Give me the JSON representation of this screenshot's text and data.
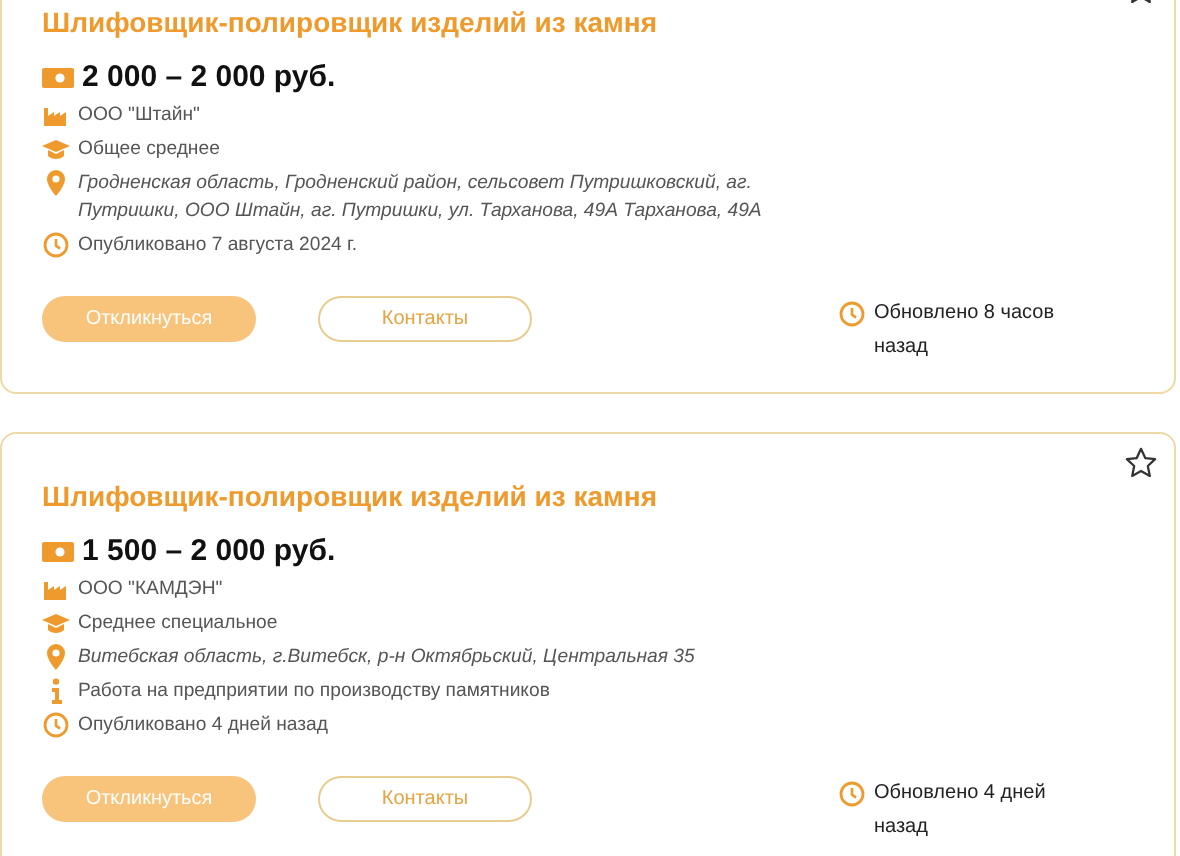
{
  "vacancies": [
    {
      "title": "Шлифовщик-полировщик изделий из камня",
      "salary": "2 000 – 2 000 руб.",
      "details": [
        {
          "kind": "company",
          "text": "ООО \"Штайн\""
        },
        {
          "kind": "education",
          "text": "Общее среднее"
        },
        {
          "kind": "location",
          "text": "Гродненская область, Гродненский район, сельсовет Путришковский, аг. Путришки, ООО Штайн, аг. Путришки, ул. Тарханова, 49А Тарханова, 49А"
        },
        {
          "kind": "published",
          "text": "Опубликовано 7 августа 2024 г."
        }
      ],
      "respond_button": "Откликнуться",
      "contacts_button": "Контакты",
      "updated": "Обновлено 8 часов назад"
    },
    {
      "title": "Шлифовщик-полировщик изделий из камня",
      "salary": "1 500 – 2 000 руб.",
      "details": [
        {
          "kind": "company",
          "text": "ООО \"КАМДЭН\""
        },
        {
          "kind": "education",
          "text": "Среднее специальное"
        },
        {
          "kind": "location",
          "text": "Витебская область, г.Витебск, р-н Октябрьский, Центральная 35"
        },
        {
          "kind": "info",
          "text": "Работа на предприятии по производству памятников"
        },
        {
          "kind": "published",
          "text": "Опубликовано 4 дней назад"
        }
      ],
      "respond_button": "Откликнуться",
      "contacts_button": "Контакты",
      "updated": "Обновлено 4 дней назад"
    }
  ]
}
